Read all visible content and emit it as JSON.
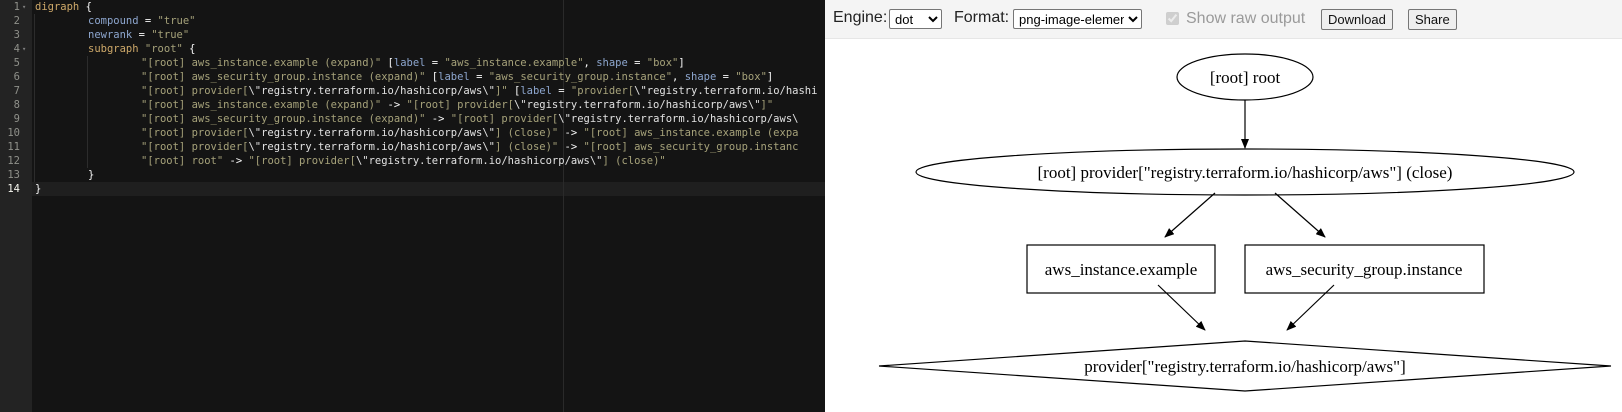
{
  "editor": {
    "active_line": 14,
    "lines": [
      {
        "n": "1",
        "tokens": [
          {
            "t": "digraph ",
            "c": "kw2"
          },
          {
            "t": "{",
            "c": "plain"
          }
        ]
      },
      {
        "n": "2",
        "tokens": [
          {
            "t": "compound",
            "c": "id"
          },
          {
            "t": " = ",
            "c": "plain"
          },
          {
            "t": "\"true\"",
            "c": "str"
          }
        ]
      },
      {
        "n": "3",
        "tokens": [
          {
            "t": "newrank",
            "c": "id"
          },
          {
            "t": " = ",
            "c": "plain"
          },
          {
            "t": "\"true\"",
            "c": "str"
          }
        ]
      },
      {
        "n": "4",
        "tokens": [
          {
            "t": "subgraph ",
            "c": "kw2"
          },
          {
            "t": "\"root\"",
            "c": "str"
          },
          {
            "t": " {",
            "c": "plain"
          }
        ]
      },
      {
        "n": "5",
        "tokens": [
          {
            "t": "\"[root] aws_instance.example (expand)\"",
            "c": "str"
          },
          {
            "t": " [",
            "c": "plain"
          },
          {
            "t": "label",
            "c": "id"
          },
          {
            "t": " = ",
            "c": "plain"
          },
          {
            "t": "\"aws_instance.example\"",
            "c": "str"
          },
          {
            "t": ", ",
            "c": "plain"
          },
          {
            "t": "shape",
            "c": "id"
          },
          {
            "t": " = ",
            "c": "plain"
          },
          {
            "t": "\"box\"",
            "c": "str"
          },
          {
            "t": "]",
            "c": "plain"
          }
        ]
      },
      {
        "n": "6",
        "tokens": [
          {
            "t": "\"[root] aws_security_group.instance (expand)\"",
            "c": "str"
          },
          {
            "t": " [",
            "c": "plain"
          },
          {
            "t": "label",
            "c": "id"
          },
          {
            "t": " = ",
            "c": "plain"
          },
          {
            "t": "\"aws_security_group.instance\"",
            "c": "str"
          },
          {
            "t": ", ",
            "c": "plain"
          },
          {
            "t": "shape",
            "c": "id"
          },
          {
            "t": " = ",
            "c": "plain"
          },
          {
            "t": "\"box\"",
            "c": "str"
          },
          {
            "t": "]",
            "c": "plain"
          }
        ]
      },
      {
        "n": "7",
        "tokens": [
          {
            "t": "\"[root] provider[",
            "c": "str"
          },
          {
            "t": "\\\"registry.terraform.io/hashicorp/aws\\\"",
            "c": "strw"
          },
          {
            "t": "]\"",
            "c": "str"
          },
          {
            "t": " [",
            "c": "plain"
          },
          {
            "t": "label",
            "c": "id"
          },
          {
            "t": " = ",
            "c": "plain"
          },
          {
            "t": "\"provider[",
            "c": "str"
          },
          {
            "t": "\\\"registry.terraform.io/hashi",
            "c": "strw"
          }
        ]
      },
      {
        "n": "8",
        "tokens": [
          {
            "t": "\"[root] aws_instance.example (expand)\"",
            "c": "str"
          },
          {
            "t": " -> ",
            "c": "plain"
          },
          {
            "t": "\"[root] provider[",
            "c": "str"
          },
          {
            "t": "\\\"registry.terraform.io/hashicorp/aws\\\"",
            "c": "strw"
          },
          {
            "t": "]\"",
            "c": "str"
          }
        ]
      },
      {
        "n": "9",
        "tokens": [
          {
            "t": "\"[root] aws_security_group.instance (expand)\"",
            "c": "str"
          },
          {
            "t": " -> ",
            "c": "plain"
          },
          {
            "t": "\"[root] provider[",
            "c": "str"
          },
          {
            "t": "\\\"registry.terraform.io/hashicorp/aws\\",
            "c": "strw"
          }
        ]
      },
      {
        "n": "10",
        "tokens": [
          {
            "t": "\"[root] provider[",
            "c": "str"
          },
          {
            "t": "\\\"registry.terraform.io/hashicorp/aws\\\"",
            "c": "strw"
          },
          {
            "t": "] (close)\"",
            "c": "str"
          },
          {
            "t": " -> ",
            "c": "plain"
          },
          {
            "t": "\"[root] aws_instance.example (expa",
            "c": "str"
          }
        ]
      },
      {
        "n": "11",
        "tokens": [
          {
            "t": "\"[root] provider[",
            "c": "str"
          },
          {
            "t": "\\\"registry.terraform.io/hashicorp/aws\\\"",
            "c": "strw"
          },
          {
            "t": "] (close)\"",
            "c": "str"
          },
          {
            "t": " -> ",
            "c": "plain"
          },
          {
            "t": "\"[root] aws_security_group.instanc",
            "c": "str"
          }
        ]
      },
      {
        "n": "12",
        "tokens": [
          {
            "t": "\"[root] root\"",
            "c": "str"
          },
          {
            "t": " -> ",
            "c": "plain"
          },
          {
            "t": "\"[root] provider[",
            "c": "str"
          },
          {
            "t": "\\\"registry.terraform.io/hashicorp/aws\\\"",
            "c": "strw"
          },
          {
            "t": "] (close)\"",
            "c": "str"
          }
        ]
      },
      {
        "n": "13",
        "tokens": [
          {
            "t": "}",
            "c": "plain"
          }
        ]
      },
      {
        "n": "14",
        "tokens": [
          {
            "t": "}",
            "c": "plain"
          }
        ]
      }
    ]
  },
  "toolbar": {
    "engine_label": "Engine:",
    "engine_value": "dot",
    "format_label": "Format:",
    "format_value": "png-image-element",
    "raw_output_label": "Show raw output",
    "raw_output_checked": true,
    "download_label": "Download",
    "share_label": "Share"
  },
  "graph": {
    "nodes": {
      "root": "[root] root",
      "provider_close": "[root] provider[\"registry.terraform.io/hashicorp/aws\"] (close)",
      "aws_instance": "aws_instance.example",
      "aws_sg": "aws_security_group.instance",
      "provider": "provider[\"registry.terraform.io/hashicorp/aws\"]"
    },
    "edges": [
      [
        "root",
        "provider_close"
      ],
      [
        "provider_close",
        "aws_instance"
      ],
      [
        "provider_close",
        "aws_sg"
      ],
      [
        "aws_instance",
        "provider"
      ],
      [
        "aws_sg",
        "provider"
      ]
    ]
  }
}
